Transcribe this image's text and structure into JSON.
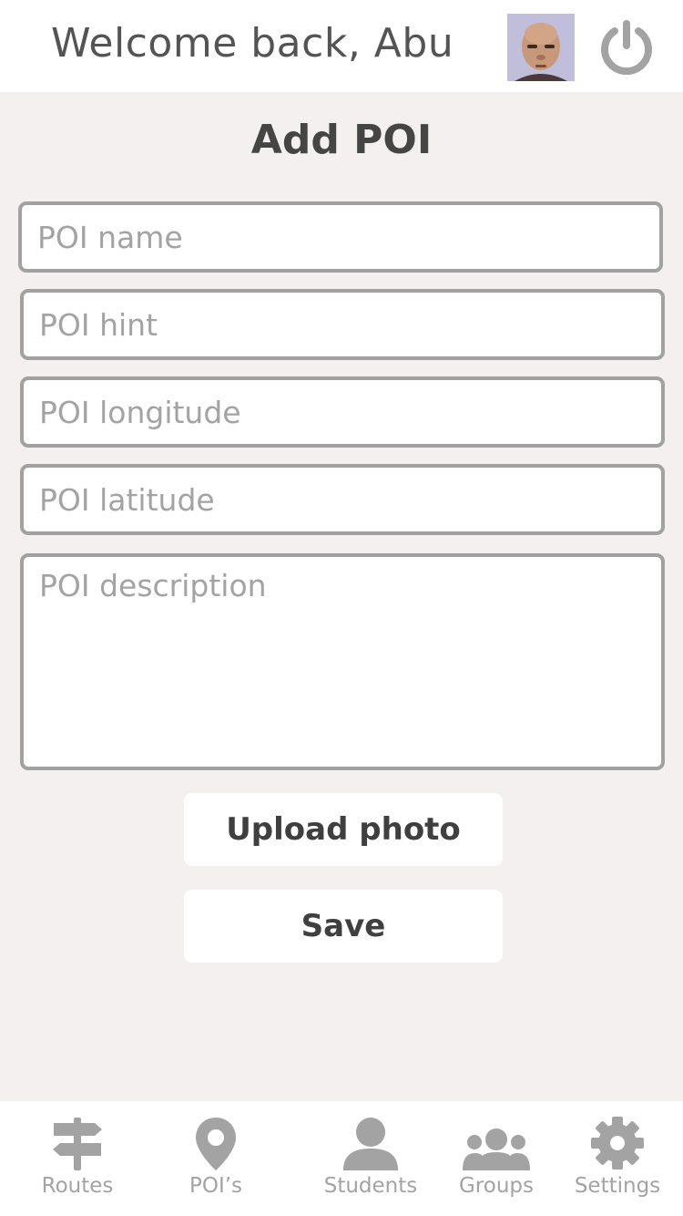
{
  "header": {
    "welcome": "Welcome back, Abu"
  },
  "page": {
    "title": "Add POI"
  },
  "form": {
    "name_placeholder": "POI name",
    "hint_placeholder": "POI hint",
    "longitude_placeholder": "POI longitude",
    "latitude_placeholder": "POI latitude",
    "description_placeholder": "POI description",
    "upload_label": "Upload photo",
    "save_label": "Save"
  },
  "nav": {
    "items": [
      {
        "label": "Routes",
        "icon": "signpost-icon"
      },
      {
        "label": "POI’s",
        "icon": "map-pin-icon"
      },
      {
        "label": "Students",
        "icon": "person-icon"
      },
      {
        "label": "Groups",
        "icon": "group-icon"
      },
      {
        "label": "Settings",
        "icon": "gear-icon"
      }
    ]
  },
  "colors": {
    "background": "#f4f0ef",
    "surface": "#ffffff",
    "border": "#a1a1a1",
    "text": "#454545",
    "muted": "#a3a3a3"
  }
}
